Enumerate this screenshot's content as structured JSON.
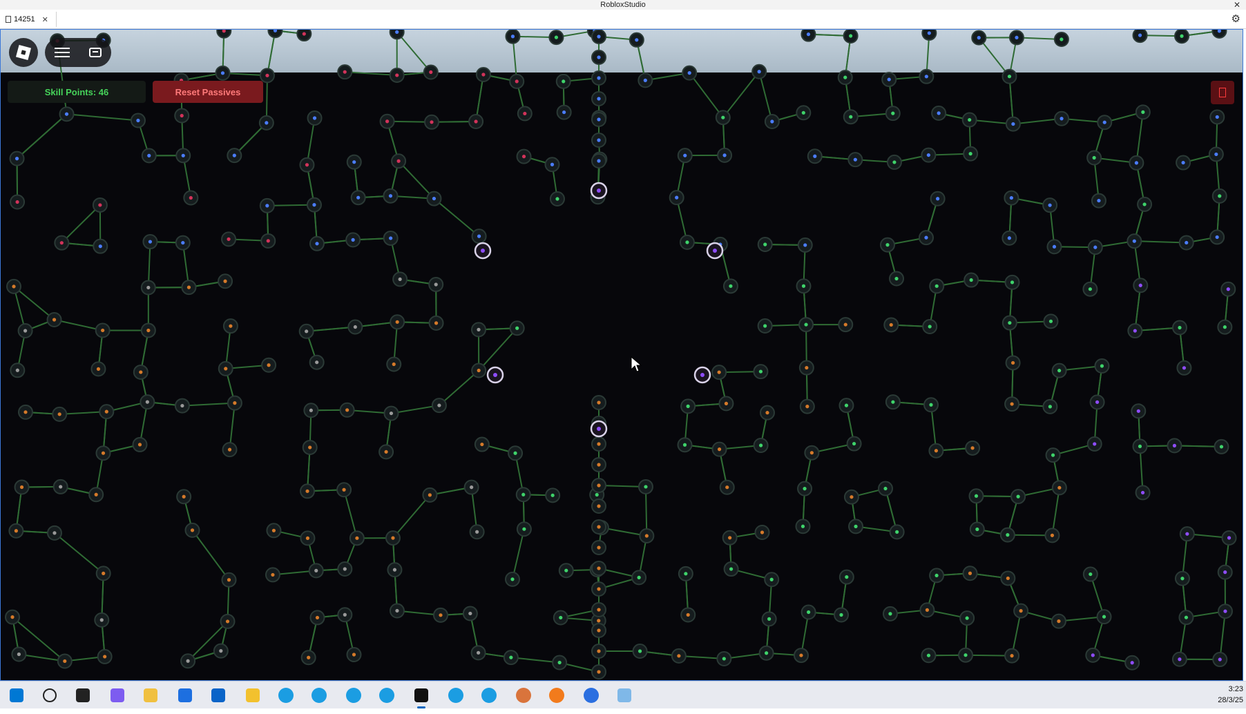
{
  "window": {
    "title": "RobloxStudio",
    "close_glyph": "✕"
  },
  "tab": {
    "label": "14251",
    "close_glyph": "✕"
  },
  "settings_icon": "gear-icon",
  "hud": {
    "roblox_icon": "roblox-logo-icon",
    "menu_icon": "hamburger-menu-icon",
    "chat_icon": "chat-icon",
    "skill_points_label": "Skill Points: 46",
    "reset_label": "Reset Passives",
    "close_icon": "close-icon"
  },
  "colors": {
    "background": "#07070b",
    "edge": "#2f6b34",
    "node_fill": "#151c1e",
    "node_blue": "#4b7dff",
    "node_red": "#d2335a",
    "node_orange": "#d57a2a",
    "node_green": "#3fd36b",
    "node_purple": "#8f4dff",
    "node_gray": "#9a9a9a",
    "skill_points_text": "#46d35a",
    "reset_bg": "#7a1a1e"
  },
  "taskbar": {
    "items": [
      {
        "name": "windows-start-icon",
        "color": "#0078d4"
      },
      {
        "name": "search-icon",
        "color": "#222222"
      },
      {
        "name": "task-view-icon",
        "color": "#222222"
      },
      {
        "name": "copilot-icon",
        "color": "#7d5cf0"
      },
      {
        "name": "file-explorer-icon",
        "color": "#f0c040"
      },
      {
        "name": "store-icon",
        "color": "#1d6fe0"
      },
      {
        "name": "outlook-icon",
        "color": "#0a64c8"
      },
      {
        "name": "app-yellow-icon",
        "color": "#f2c12e"
      },
      {
        "name": "edge-icon",
        "color": "#1b9de2"
      },
      {
        "name": "edge-icon",
        "color": "#1b9de2"
      },
      {
        "name": "edge-icon",
        "color": "#1b9de2"
      },
      {
        "name": "edge-icon",
        "color": "#1b9de2"
      },
      {
        "name": "roblox-studio-icon",
        "color": "#111111"
      },
      {
        "name": "edge-icon",
        "color": "#1b9de2"
      },
      {
        "name": "edge-icon",
        "color": "#1b9de2"
      },
      {
        "name": "claude-icon",
        "color": "#d9743c"
      },
      {
        "name": "firefox-icon",
        "color": "#f27b1c"
      },
      {
        "name": "camera-icon",
        "color": "#2b6fe0"
      },
      {
        "name": "notepad-icon",
        "color": "#7fb8e8"
      }
    ],
    "active_item": 12,
    "clock_time": "3:23",
    "clock_date": "28/3/25"
  }
}
